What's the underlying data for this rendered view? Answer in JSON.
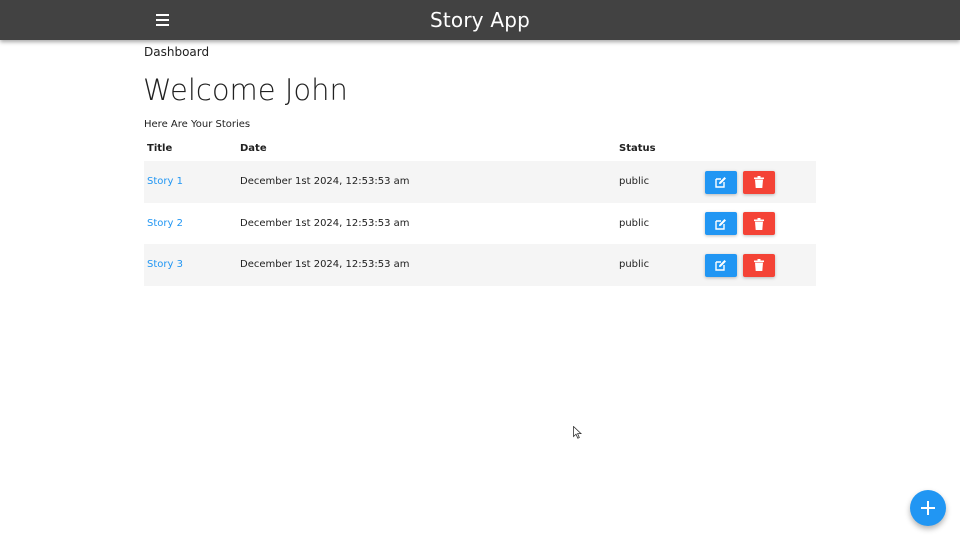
{
  "appbar": {
    "title": "Story App",
    "menu_icon": "hamburger-menu-icon",
    "background": "#424242"
  },
  "breadcrumb": "Dashboard",
  "page": {
    "title": "Welcome John",
    "subtitle": "Here Are Your Stories"
  },
  "table": {
    "headers": {
      "title": "Title",
      "date": "Date",
      "status": "Status"
    },
    "rows": [
      {
        "title": "Story 1",
        "date": "December 1st 2024, 12:53:53 am",
        "status": "public"
      },
      {
        "title": "Story 2",
        "date": "December 1st 2024, 12:53:53 am",
        "status": "public"
      },
      {
        "title": "Story 3",
        "date": "December 1st 2024, 12:53:53 am",
        "status": "public"
      }
    ],
    "edit_icon": "edit-icon",
    "delete_icon": "trash-icon"
  },
  "fab": {
    "icon": "plus-icon"
  },
  "colors": {
    "primary": "#2196f3",
    "danger": "#f44336",
    "row_alt": "#f5f5f5"
  }
}
